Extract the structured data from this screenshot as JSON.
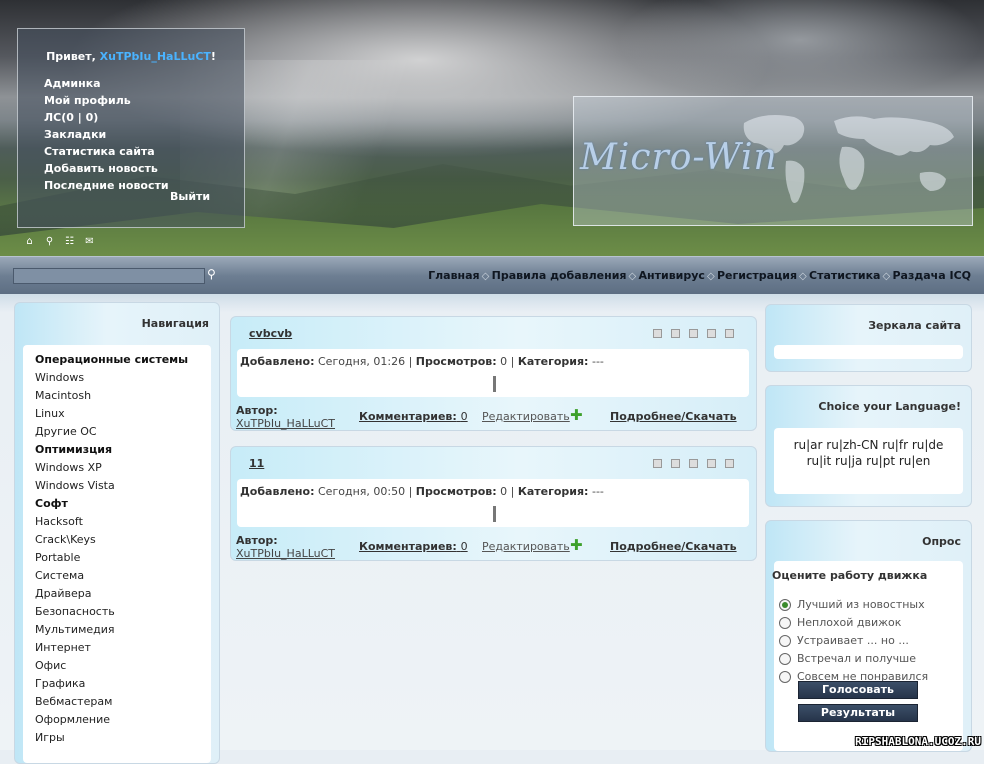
{
  "header": {
    "greeting": "Привет,",
    "username": "XuTPbIu_HaLLuCT",
    "user_links": [
      "Админка",
      "Мой профиль",
      "ЛС(0 | 0)",
      "Закладки",
      "Статистика сайта",
      "Добавить новость",
      "Последние новости"
    ],
    "logout": "Выйти",
    "logo_text": "Micro-Win",
    "icons": [
      "home-icon",
      "search-icon",
      "sitemap-icon",
      "mail-icon"
    ]
  },
  "navbar": {
    "search_placeholder": "",
    "menu": [
      "Главная",
      "Правила добавления",
      "Антивирус",
      "Регистрация",
      "Статистика",
      "Раздача ICQ"
    ]
  },
  "left": {
    "title": "Навигация",
    "items": [
      {
        "label": "Операционные системы",
        "header": true
      },
      {
        "label": "Windows",
        "header": false
      },
      {
        "label": "Macintosh",
        "header": false
      },
      {
        "label": "Linux",
        "header": false
      },
      {
        "label": "Другие ОС",
        "header": false
      },
      {
        "label": "Оптимизция",
        "header": true
      },
      {
        "label": "Windows XP",
        "header": false
      },
      {
        "label": "Windows Vista",
        "header": false
      },
      {
        "label": "Софт",
        "header": true
      },
      {
        "label": "Hacksoft",
        "header": false
      },
      {
        "label": "Crack\\Keys",
        "header": false
      },
      {
        "label": "Portable",
        "header": false
      },
      {
        "label": "Система",
        "header": false
      },
      {
        "label": "Драйвера",
        "header": false
      },
      {
        "label": "Безопасность",
        "header": false
      },
      {
        "label": "Мультимедия",
        "header": false
      },
      {
        "label": "Интернет",
        "header": false
      },
      {
        "label": "Офис",
        "header": false
      },
      {
        "label": "Графика",
        "header": false
      },
      {
        "label": "Вебмастерам",
        "header": false
      },
      {
        "label": "Оформление",
        "header": false
      },
      {
        "label": "Игры",
        "header": false
      }
    ]
  },
  "posts": [
    {
      "title": "cvbcvb",
      "added_label": "Добавлено:",
      "added": "Сегодня, 01:26",
      "views_label": "Просмотров:",
      "views": "0",
      "category_label": "Категория:",
      "category": "---",
      "author_label": "Автор:",
      "author": "XuTPbIu_HaLLuCT",
      "comments_label": "Комментариев:",
      "comments": "0",
      "edit": "Редактировать",
      "more": "Подробнее/Скачать"
    },
    {
      "title": "11",
      "added_label": "Добавлено:",
      "added": "Сегодня, 00:50",
      "views_label": "Просмотров:",
      "views": "0",
      "category_label": "Категория:",
      "category": "---",
      "author_label": "Автор:",
      "author": "XuTPbIu_HaLLuCT",
      "comments_label": "Комментариев:",
      "comments": "0",
      "edit": "Редактировать",
      "more": "Подробнее/Скачать"
    }
  ],
  "right": {
    "mirrors_title": "Зеркала сайта",
    "lang_title": "Choice your Language!",
    "lang_line1": "ru|ar ru|zh-CN ru|fr ru|de",
    "lang_line2": "ru|it ru|ja ru|pt ru|en",
    "poll_title": "Опрос",
    "poll_question": "Оцените работу движка",
    "poll_options": [
      "Лучший из новостных",
      "Неплохой движок",
      "Устраивает ... но ...",
      "Встречал и получше",
      "Совсем не понравился"
    ],
    "vote": "Голосовать",
    "results": "Результаты"
  },
  "watermark": "RIPSHABLONA.UCOZ.RU"
}
